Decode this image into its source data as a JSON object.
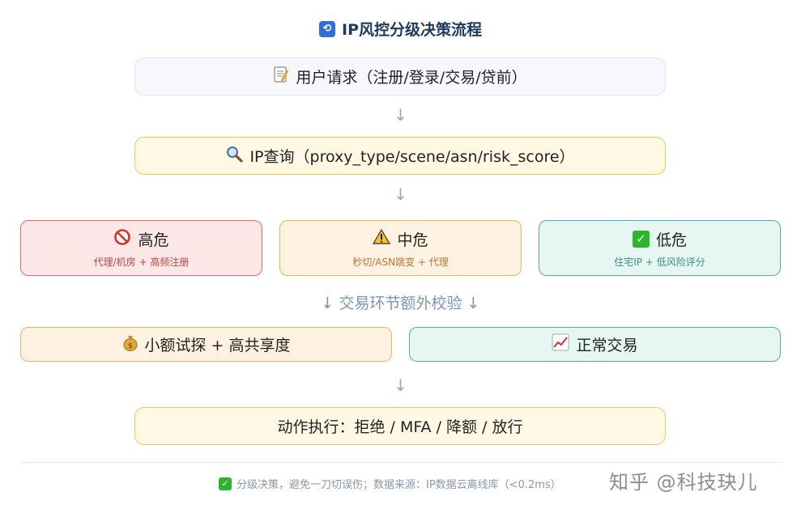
{
  "title": "IP风控分级决策流程",
  "flow": {
    "request": "用户请求（注册/登录/交易/贷前）",
    "query": "IP查询（proxy_type/scene/asn/risk_score）",
    "arrow": "↓",
    "risk_levels": [
      {
        "label": "高危",
        "detail": "代理/机房 + 高频注册",
        "icon": "no-entry-icon"
      },
      {
        "label": "中危",
        "detail": "秒切/ASN跳变 + 代理",
        "icon": "warning-icon"
      },
      {
        "label": "低危",
        "detail": "住宅IP + 低风险评分",
        "icon": "check-icon"
      }
    ],
    "transaction_check": "↓ 交易环节额外校验 ↓",
    "probe": "小额试探 + 高共享度",
    "normal": "正常交易",
    "execute": "动作执行：拒绝 / MFA / 降额 / 放行"
  },
  "footer": "分级决策，避免一刀切误伤；数据来源：IP数据云离线库（<0.2ms）",
  "watermark": "知乎 @科技玦儿",
  "colors": {
    "high": "#e26b61",
    "mid": "#f0b060",
    "low": "#5aa7b4",
    "accent": "#eec95a"
  }
}
